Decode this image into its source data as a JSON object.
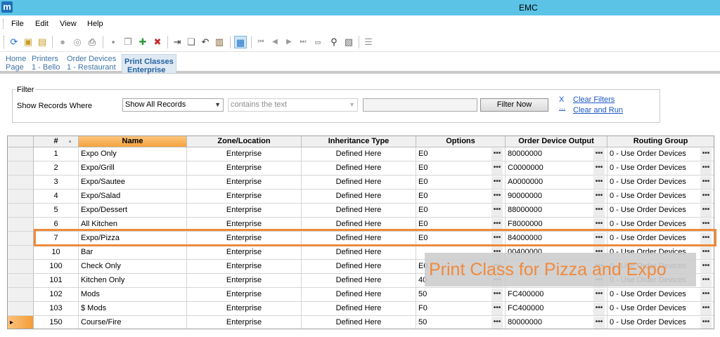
{
  "window": {
    "icon_letter": "m",
    "title": "EMC"
  },
  "menu": [
    "File",
    "Edit",
    "View",
    "Help"
  ],
  "toolbar": {
    "icons": [
      "refresh-icon",
      "open-folder-icon",
      "folder-stack-icon",
      "stop-icon",
      "search-icon",
      "print-icon",
      "save-icon",
      "copy-icon",
      "add-icon",
      "delete-icon",
      "move-icon",
      "duplicate-icon",
      "undo-icon",
      "paste-icon",
      "grid-view-icon",
      "first-record-icon",
      "previous-record-icon",
      "next-record-icon",
      "last-record-icon",
      "go-to-record-icon",
      "find-icon",
      "report-icon",
      "list-icon"
    ]
  },
  "tabs": [
    {
      "line1": "Home",
      "line2": "Page"
    },
    {
      "line1": "Printers",
      "line2": "1 - Bello"
    },
    {
      "line1": "Order Devices",
      "line2": "1 - Restaurant"
    },
    {
      "line1": "Print Classes",
      "line2": "Enterprise"
    }
  ],
  "filter": {
    "legend": "Filter",
    "label": "Show Records Where",
    "field_select": "Show All Records",
    "operator_select": "contains the text",
    "value": "",
    "button": "Filter Now",
    "clear_glyph": "X",
    "clear_link": "Clear Filters",
    "run_glyph": "...",
    "run_link": "Clear and Run"
  },
  "grid": {
    "columns": [
      "#",
      "Name",
      "Zone/Location",
      "Inheritance Type",
      "Options",
      "Order Device Output",
      "Routing Group"
    ],
    "ellipsis": "•••",
    "rows": [
      {
        "num": "1",
        "name": "Expo Only",
        "zone": "Enterprise",
        "inherit": "Defined Here",
        "options": "E0",
        "output": "80000000",
        "routing": "0 - Use Order Devices"
      },
      {
        "num": "2",
        "name": "Expo/Grill",
        "zone": "Enterprise",
        "inherit": "Defined Here",
        "options": "E0",
        "output": "C0000000",
        "routing": "0 - Use Order Devices"
      },
      {
        "num": "3",
        "name": "Expo/Sautee",
        "zone": "Enterprise",
        "inherit": "Defined Here",
        "options": "E0",
        "output": "A0000000",
        "routing": "0 - Use Order Devices"
      },
      {
        "num": "4",
        "name": "Expo/Salad",
        "zone": "Enterprise",
        "inherit": "Defined Here",
        "options": "E0",
        "output": "90000000",
        "routing": "0 - Use Order Devices"
      },
      {
        "num": "5",
        "name": "Expo/Dessert",
        "zone": "Enterprise",
        "inherit": "Defined Here",
        "options": "E0",
        "output": "88000000",
        "routing": "0 - Use Order Devices"
      },
      {
        "num": "6",
        "name": "All Kitchen",
        "zone": "Enterprise",
        "inherit": "Defined Here",
        "options": "E0",
        "output": "F8000000",
        "routing": "0 - Use Order Devices"
      },
      {
        "num": "7",
        "name": "Expo/Pizza",
        "zone": "Enterprise",
        "inherit": "Defined Here",
        "options": "E0",
        "output": "84000000",
        "routing": "0 - Use Order Devices"
      },
      {
        "num": "10",
        "name": "Bar",
        "zone": "Enterprise",
        "inherit": "Defined Here",
        "options": "",
        "output": "00400000",
        "routing": "0 - Use Order Devices"
      },
      {
        "num": "100",
        "name": "Check Only",
        "zone": "Enterprise",
        "inherit": "Defined Here",
        "options": "E0",
        "output": "",
        "routing": "0 - Use Order Devices"
      },
      {
        "num": "101",
        "name": "Kitchen Only",
        "zone": "Enterprise",
        "inherit": "Defined Here",
        "options": "40",
        "output": "",
        "routing": "0 - Use Order Devices"
      },
      {
        "num": "102",
        "name": "Mods",
        "zone": "Enterprise",
        "inherit": "Defined Here",
        "options": "50",
        "output": "FC400000",
        "routing": "0 - Use Order Devices"
      },
      {
        "num": "103",
        "name": "$ Mods",
        "zone": "Enterprise",
        "inherit": "Defined Here",
        "options": "F0",
        "output": "FC400000",
        "routing": "0 - Use Order Devices"
      },
      {
        "num": "150",
        "name": "Course/Fire",
        "zone": "Enterprise",
        "inherit": "Defined Here",
        "options": "50",
        "output": "80000000",
        "routing": "0 - Use Order Devices"
      }
    ]
  },
  "callout": {
    "text": "Print Class for Pizza and Expo",
    "color": "#f08a3d"
  },
  "colors": {
    "titlebar": "#5bc3e6",
    "header_sorted": "#f5a23e",
    "highlight": "#ee8a3d",
    "link": "#1b56c8"
  }
}
